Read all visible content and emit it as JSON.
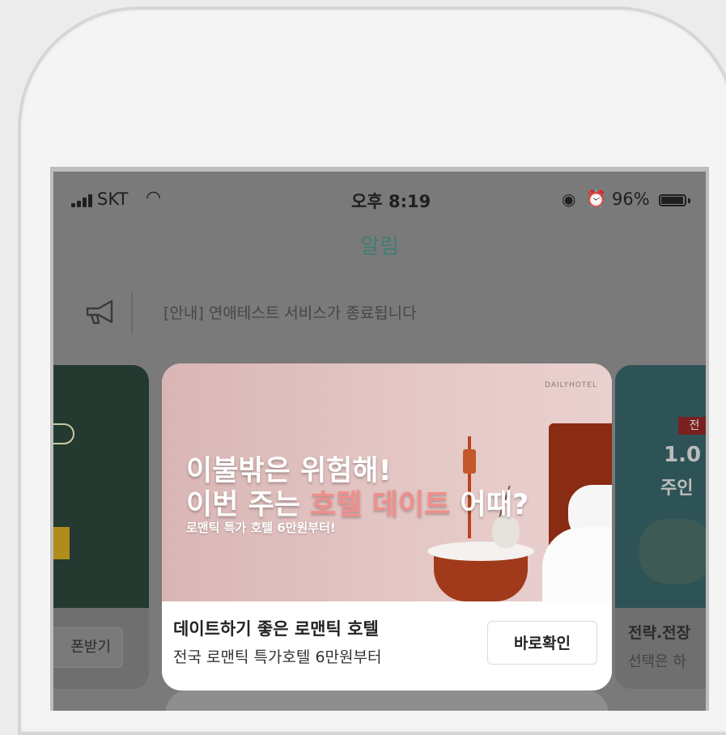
{
  "status_bar": {
    "carrier": "SKT",
    "time": "오후 8:19",
    "battery_percent": "96%",
    "battery_level": 0.96,
    "icons": [
      "signal-icon",
      "wifi-icon",
      "rotation-lock-icon",
      "alarm-icon",
      "battery-icon"
    ]
  },
  "nav": {
    "title": "알림"
  },
  "notice": {
    "text": "[안내] 연애테스트 서비스가 종료됩니다",
    "icon": "megaphone-icon"
  },
  "left_card": {
    "button_label": "폰받기"
  },
  "right_card": {
    "tag": "전",
    "big_text": "1.0",
    "big_text_2": "주인",
    "title": "전략.전장",
    "subtitle": "선택은 하"
  },
  "popup": {
    "brand": "DAILYHOTEL",
    "headline_1": "이불밖은 위험해!",
    "headline_2_prefix": "이번 주는 ",
    "headline_2_emphasis": "호텔 데이트",
    "headline_2_suffix": " 어때?",
    "headline_3": "로맨틱 특가 호텔 6만원부터!",
    "title": "데이트하기 좋은 로맨틱 호텔",
    "subtitle": "전국 로맨틱 특가호텔 6만원부터",
    "button_label": "바로확인"
  },
  "colors": {
    "overlay": "#7a7a7a",
    "title_accent": "#3f7e75",
    "hero_emphasis": "#ef8f8c"
  }
}
